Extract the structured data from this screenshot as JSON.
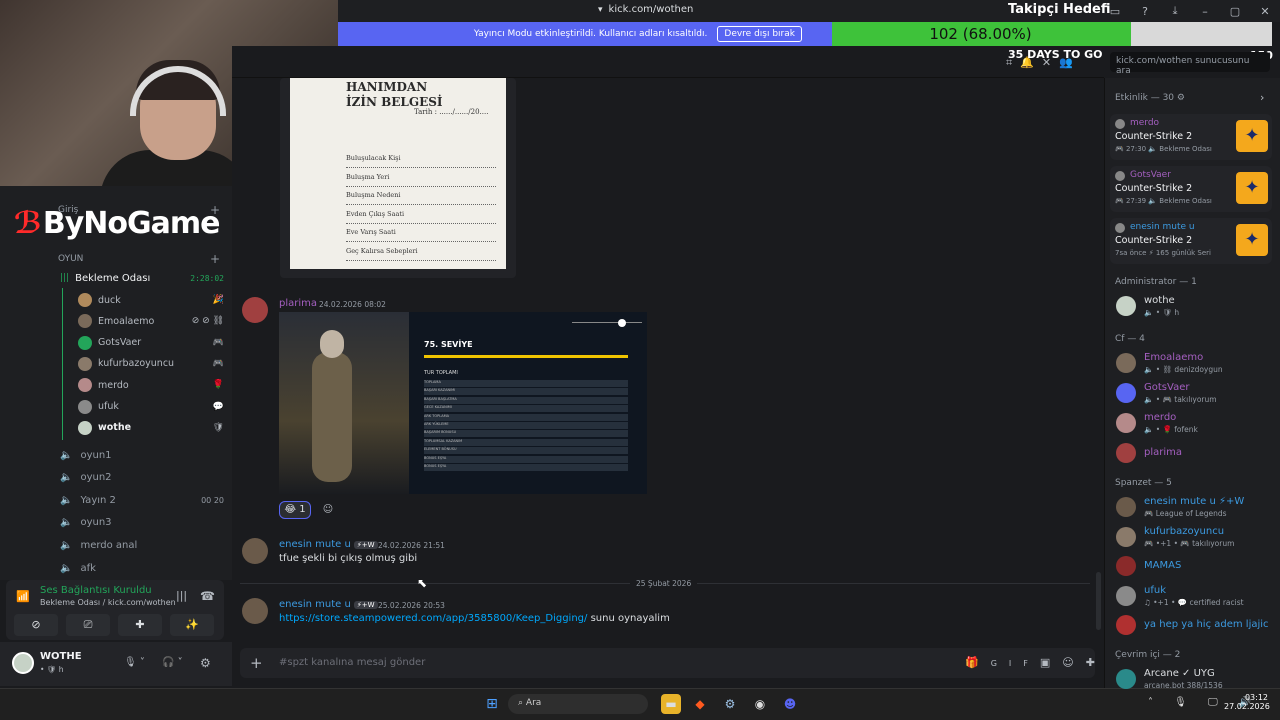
{
  "browser": {
    "url": "kick.com/wothen",
    "window_buttons": [
      "▭",
      "?",
      "⤓",
      "–",
      "▢",
      "✕"
    ]
  },
  "follower_goal": {
    "title": "Takipçi Hedefi",
    "progress_text": "102 (68.00%)",
    "progress_fraction": 0.68,
    "min": "0",
    "max": "150",
    "days": "35 DAYS TO GO",
    "fill_color": "#3ec23a"
  },
  "mod_banner": {
    "text": "Yayıncı Modu etkinleştirildi. Kullanıcı adları kısaltıldı.",
    "button": "Devre dışı bırak",
    "color": "#5865f2"
  },
  "header": {
    "search_placeholder": "kick.com/wothen sunucusunu ara"
  },
  "logo": {
    "text": "ByNoGame",
    "mark": "ℬ"
  },
  "sidebar": {
    "section_giris": "Giriş",
    "section_oyun": "OYUN",
    "voice_channel": {
      "name": "Bekleme Odası",
      "timer": "2:28:02"
    },
    "voice_users": [
      {
        "name": "duck",
        "color": "#b08a5c",
        "icon": "🎉"
      },
      {
        "name": "Emoalaemo",
        "color": "#7a6a5a",
        "icon": "⊘ ⊘ ⛓"
      },
      {
        "name": "GotsVaer",
        "color": "#23a55a",
        "icon": "🎮"
      },
      {
        "name": "kufurbazoyuncu",
        "color": "#8a7a6a",
        "icon": "🎮"
      },
      {
        "name": "merdo",
        "color": "#b58a8a",
        "icon": "🌹"
      },
      {
        "name": "ufuk",
        "color": "#8a8a8a",
        "icon": "💬"
      },
      {
        "name": "wothe",
        "color": "#c6d2c6",
        "icon": "🛡"
      }
    ],
    "channels": [
      {
        "name": "oyun1",
        "count": ""
      },
      {
        "name": "oyun2",
        "count": ""
      },
      {
        "name": "Yayın 2",
        "count": "00  20"
      },
      {
        "name": "oyun3",
        "count": ""
      },
      {
        "name": "merdo anal",
        "count": ""
      },
      {
        "name": "afk",
        "count": ""
      }
    ]
  },
  "voice_panel": {
    "status": "Ses Bağlantısı Kuruldu",
    "sub": "Bekleme Odası / kick.com/wothen",
    "buttons": [
      "⊘",
      "⎚",
      "✚",
      "✨"
    ]
  },
  "user_panel": {
    "name": "WOTHE",
    "sub": "• 🛡 h",
    "controls": [
      "🎙 ˅",
      "🎧 ˅",
      "⚙"
    ]
  },
  "chat": {
    "document": {
      "title": "HANIMDAN\nİZİN BELGESİ",
      "date_label": "Tarih : ....../....../20....",
      "lines": [
        "Buluşulacak Kişi",
        "Buluşma Yeri",
        "Buluşma Nedeni",
        "Evden Çıkış Saati",
        "Eve Varış Saati",
        "Geç Kalırsa Sebepleri"
      ]
    },
    "messages": [
      {
        "author": "plarima",
        "author_color": "#a45fc0",
        "time": "24.02.2026 08:02",
        "game": {
          "title": "75. SEVİYE",
          "summary": "TUR TOPLAMI",
          "rows": [
            "TOPLAMA",
            "BAŞARI KAZANIMI",
            "BAŞARI BAŞLATMA",
            "GECE KAZANIMI",
            "ARK TOPLAMA",
            "ARK YÜKLEME",
            "BAŞARIM BONUSU",
            "TOPLUMSAL KAZANIM",
            "ELEMENT BÖNUSU",
            "BONUS EŞYA",
            "BONUS EŞYA"
          ]
        },
        "reaction": {
          "emoji": "😂",
          "count": "1"
        }
      },
      {
        "author": "enesin mute u",
        "author_color": "#3c9ae0",
        "badge": "⚡+W",
        "time": "24.02.2026 21:51",
        "text": "tfue şekli bi çıkış olmuş gibi"
      },
      {
        "author": "enesin mute u",
        "author_color": "#3c9ae0",
        "badge": "⚡+W",
        "time": "25.02.2026 20:53",
        "link": "https://store.steampowered.com/app/3585800/Keep_Digging/",
        "text": " sunu oynayalim"
      }
    ],
    "date_divider": "25 Şubat 2026",
    "input_placeholder": "#spzt kanalına mesaj gönder",
    "input_icons": [
      "🎁",
      "GIF",
      "▣",
      "☺",
      "✚"
    ]
  },
  "right_panel": {
    "activity_title": "Etkinlik — 30 ⚙",
    "activities": [
      {
        "user": "merdo",
        "user_color": "#a45fc0",
        "game": "Counter-Strike 2",
        "meta": "🎮 27:30  🔈 Bekleme Odası"
      },
      {
        "user": "GotsVaer",
        "user_color": "#a45fc0",
        "game": "Counter-Strike 2",
        "meta": "🎮 27:39  🔈 Bekleme Odası"
      },
      {
        "user": "enesin mute u",
        "user_color": "#3c9ae0",
        "game": "Counter-Strike 2",
        "meta": "7sa önce  ⚡ 165 günlük Seri"
      }
    ],
    "sections": [
      {
        "title": "Administrator — 1",
        "members": [
          {
            "name": "wothe",
            "color": "#dbdee1",
            "sub": "🔈 • 🛡 h",
            "av": "#c6d2c6"
          }
        ]
      },
      {
        "title": "Cf — 4",
        "members": [
          {
            "name": "Emoalaemo",
            "color": "#a45fc0",
            "sub": "🔈 • ⛓ denizdoygun",
            "av": "#7a6a5a"
          },
          {
            "name": "GotsVaer",
            "color": "#a45fc0",
            "sub": "🔈 • 🎮 takılıyorum",
            "av": "#5865f2"
          },
          {
            "name": "merdo",
            "color": "#a45fc0",
            "sub": "🔈 • 🌹 fofenk",
            "av": "#b58a8a"
          },
          {
            "name": "plarima",
            "color": "#a45fc0",
            "sub": "",
            "av": "#a04040"
          }
        ]
      },
      {
        "title": "Spanzet — 5",
        "members": [
          {
            "name": "enesin mute u ⚡+W",
            "color": "#3c9ae0",
            "sub": "🎮 League of Legends",
            "av": "#6a5a4a"
          },
          {
            "name": "kufurbazoyuncu",
            "color": "#3c9ae0",
            "sub": "🎮 •+1 • 🎮 takılıyorum",
            "av": "#8a7a6a"
          },
          {
            "name": "MAMAS",
            "color": "#3c9ae0",
            "sub": "",
            "av": "#8a2a2a"
          },
          {
            "name": "ufuk",
            "color": "#3c9ae0",
            "sub": "♫ •+1 • 💬 certified racist",
            "av": "#8a8a8a"
          },
          {
            "name": "ya hep ya hiç adem ljajic",
            "color": "#3c9ae0",
            "sub": "",
            "av": "#b03030"
          }
        ]
      },
      {
        "title": "Çevrim içi — 2",
        "members": [
          {
            "name": "Arcane ✓ UYG",
            "color": "#dbdee1",
            "sub": "arcane.bot 388/1536",
            "av": "#2a8a8a"
          }
        ]
      }
    ]
  },
  "taskbar": {
    "search": "Ara",
    "time": "03:12",
    "date": "27.02.2026",
    "tray": "˄ 🎙 🖵 🔊"
  }
}
